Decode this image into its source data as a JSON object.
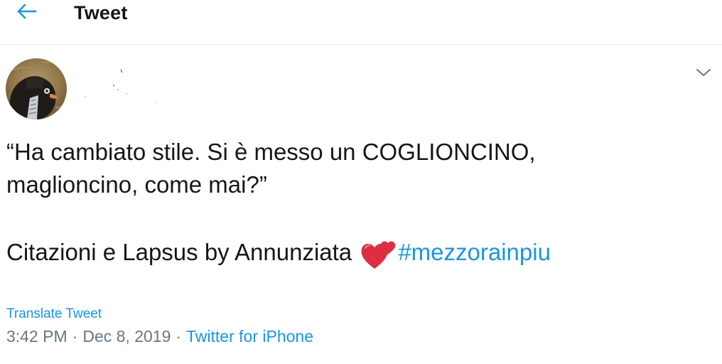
{
  "header": {
    "title": "Tweet",
    "back_icon": "arrow-left-icon"
  },
  "tweet": {
    "line1": "“Ha cambiato stile. Si è messo un COGLIONCINO,",
    "line2": "maglioncino, come mai?”",
    "line3_text": "Citazioni e Lapsus by Annunziata",
    "emoji": "two-hearts-emoji",
    "hashtag": "#mezzorainpiu",
    "translate_label": "Translate Tweet",
    "time": "3:42 PM",
    "separator": "·",
    "date": "Dec 8, 2019",
    "source": "Twitter for iPhone"
  },
  "colors": {
    "accent": "#1b95e0",
    "text": "#14171a",
    "muted": "#657786",
    "divider": "#e6ecf0"
  }
}
